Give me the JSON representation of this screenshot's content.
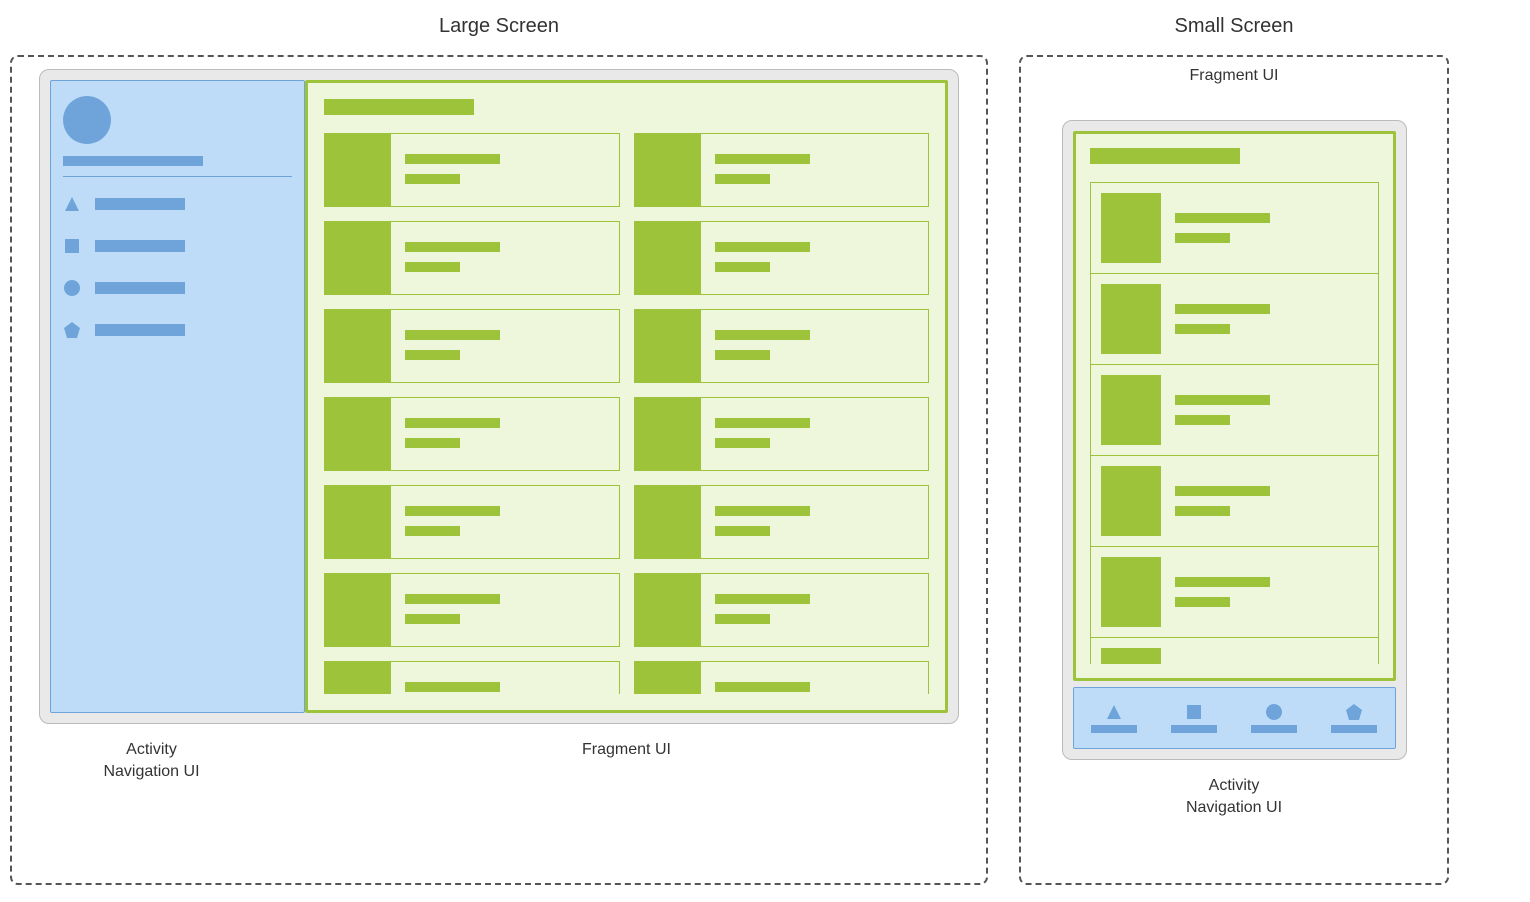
{
  "titles": {
    "large": "Large Screen",
    "small": "Small Screen"
  },
  "captions": {
    "activity_line1": "Activity",
    "activity_line2": "Navigation UI",
    "fragment": "Fragment UI"
  },
  "colors": {
    "nav_bg": "#bedcf7",
    "nav_fg": "#6fa4db",
    "frag_border": "#9dc33b",
    "frag_bg": "#eef7dc"
  },
  "nav_items": [
    {
      "icon": "triangle"
    },
    {
      "icon": "square"
    },
    {
      "icon": "circle"
    },
    {
      "icon": "pentagon"
    }
  ],
  "large_fragment_card_count": 14,
  "small_fragment_card_count": 6
}
